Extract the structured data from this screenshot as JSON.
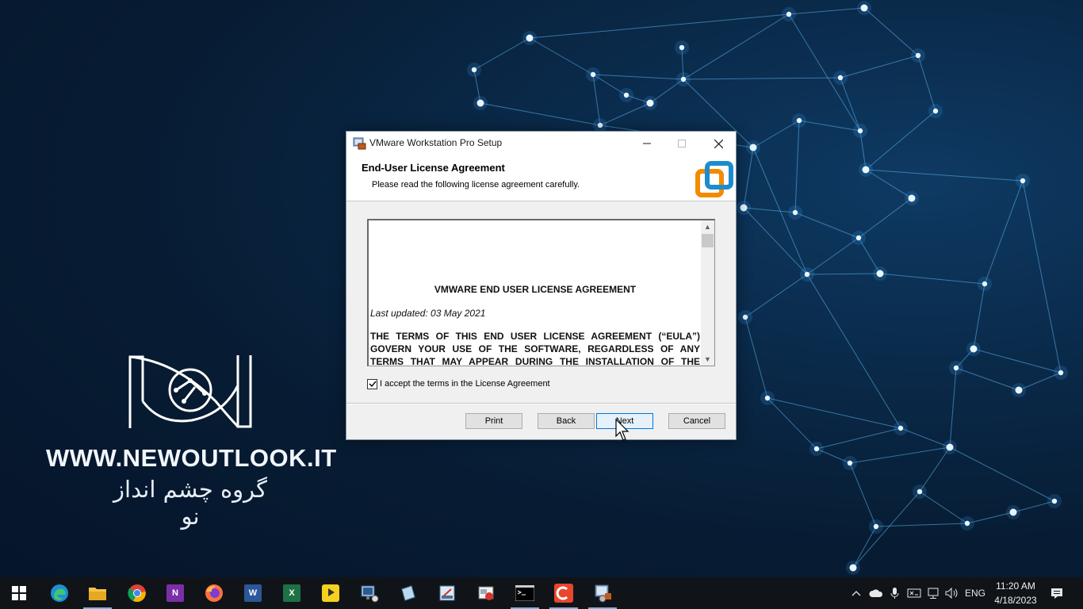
{
  "watermark": {
    "url": "WWW.NEWOUTLOOK.IT",
    "persian_text": "گروه چشم انداز نو"
  },
  "dialog": {
    "title": "VMware Workstation Pro Setup",
    "header_title": "End-User License Agreement",
    "header_subtitle": "Please read the following license agreement carefully.",
    "eula": {
      "heading": "VMWARE END USER LICENSE AGREEMENT",
      "last_updated": "Last updated: 03 May 2021",
      "body": "THE TERMS OF THIS END USER LICENSE AGREEMENT (“EULA”) GOVERN YOUR USE OF THE SOFTWARE, REGARDLESS OF ANY TERMS THAT MAY APPEAR DURING THE INSTALLATION OF THE SOFTWARE."
    },
    "accept_label": "I accept the terms in the License Agreement",
    "accept_checked": true,
    "buttons": {
      "print": "Print",
      "back": "Back",
      "next": "Next",
      "cancel": "Cancel"
    }
  },
  "taskbar": {
    "language": "ENG",
    "time": "11:20 AM",
    "date": "4/18/2023",
    "pinned": [
      "start",
      "edge",
      "file-explorer",
      "chrome",
      "onenote",
      "firefox",
      "word",
      "excel",
      "kmplayer",
      "vmware-workstation",
      "app",
      "app",
      "app",
      "command-prompt",
      "app",
      "vmware-setup"
    ]
  },
  "colors": {
    "accent": "#0078d7",
    "vmware_orange": "#f38b00",
    "vmware_blue": "#1d8ccd"
  }
}
